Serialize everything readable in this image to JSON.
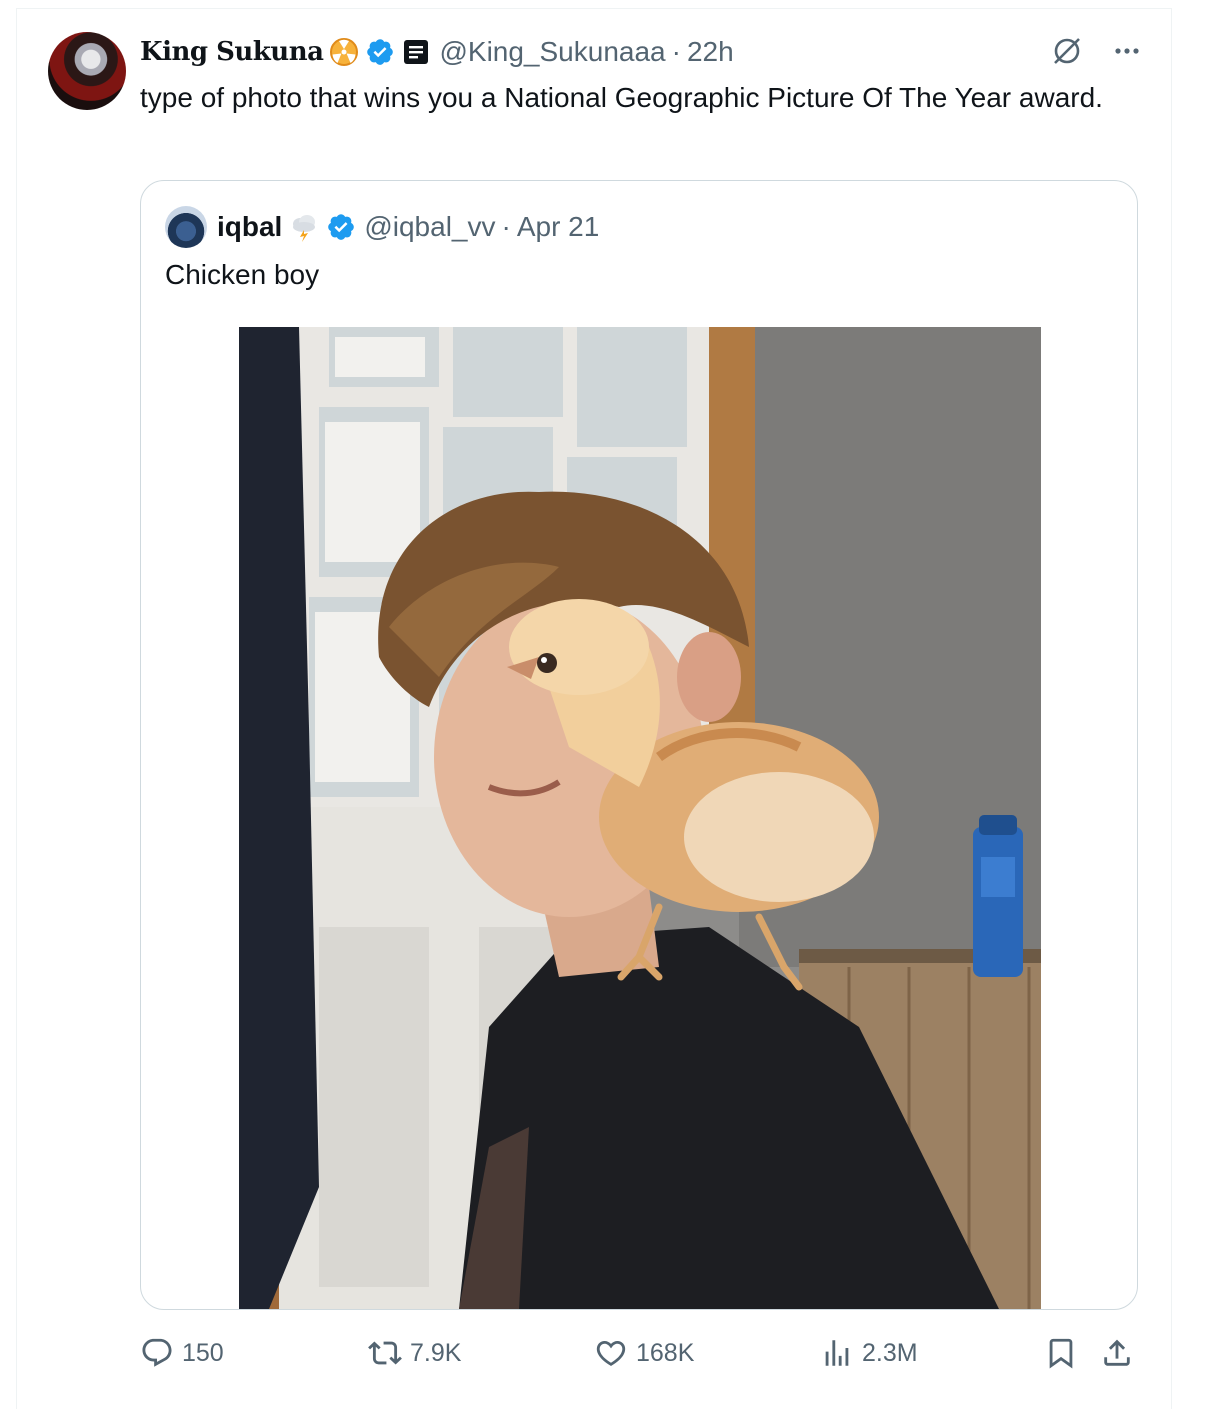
{
  "tweet": {
    "author_name": "King Sukuna",
    "handle": "@King_Sukunaaa",
    "time": "22h",
    "text": "type of photo that wins you a National Geographic Picture Of The Year award."
  },
  "quote": {
    "author_name": "iqbal",
    "handle": "@iqbal_vv",
    "date": "Apr 21",
    "text": "Chicken boy"
  },
  "actions": {
    "replies": "150",
    "reposts": "7.9K",
    "likes": "168K",
    "views": "2.3M"
  },
  "icons": {
    "more": "more-icon",
    "grok": "grok-icon",
    "reply": "reply-icon",
    "repost": "repost-icon",
    "like": "like-icon",
    "views": "views-icon",
    "bookmark": "bookmark-icon",
    "share": "share-icon"
  },
  "colors": {
    "verified": "#1d9bf0",
    "secondary_text": "#536471",
    "border": "#cfd9de"
  }
}
